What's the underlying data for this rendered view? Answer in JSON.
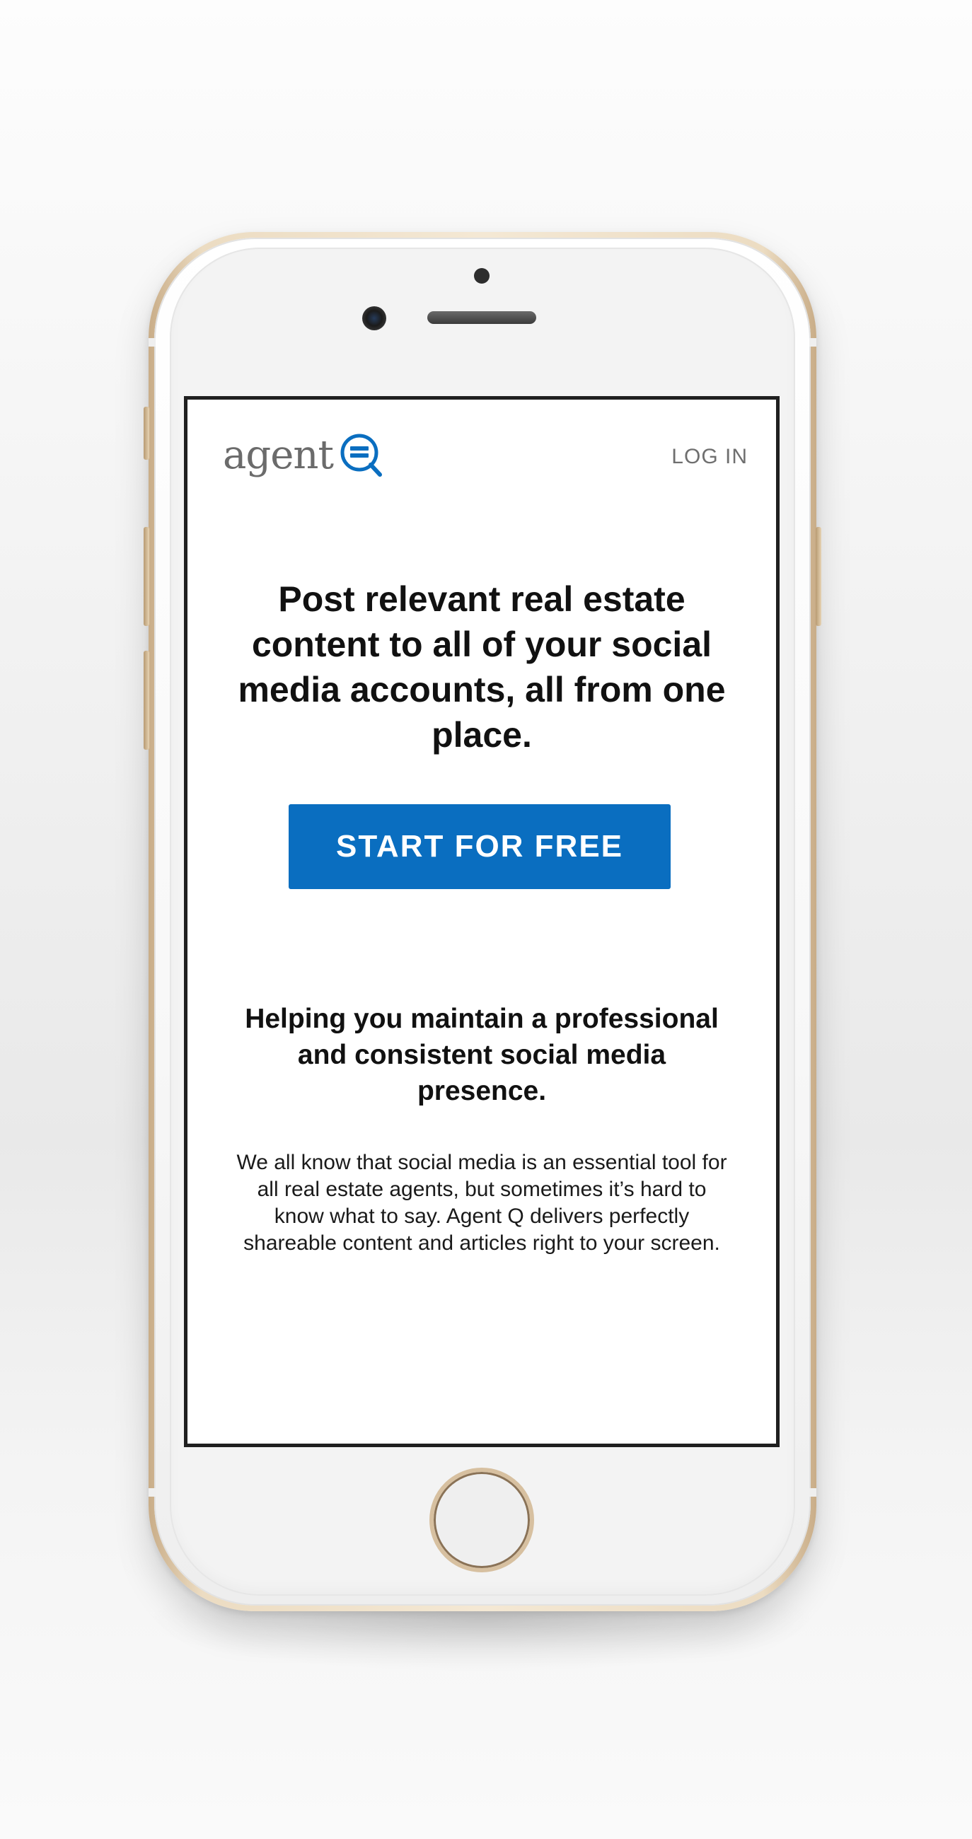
{
  "app": {
    "logo_text": "agent",
    "nav": {
      "login_label": "LOG IN"
    }
  },
  "hero": {
    "headline": "Post relevant real estate content to all of your social media accounts, all from one place.",
    "cta_label": "START FOR FREE"
  },
  "section": {
    "heading": "Helping you maintain a professional and consistent social media presence.",
    "body": "We all know that social media is an essential tool for all real estate agents, but sometimes it’s hard to know what to say. Agent Q delivers perfectly shareable content and articles right to your screen."
  },
  "colors": {
    "brand_blue": "#0a6ec0",
    "phone_gold": "#ecdcc2"
  },
  "icons": {
    "logo": "agent-q-logo-icon"
  }
}
